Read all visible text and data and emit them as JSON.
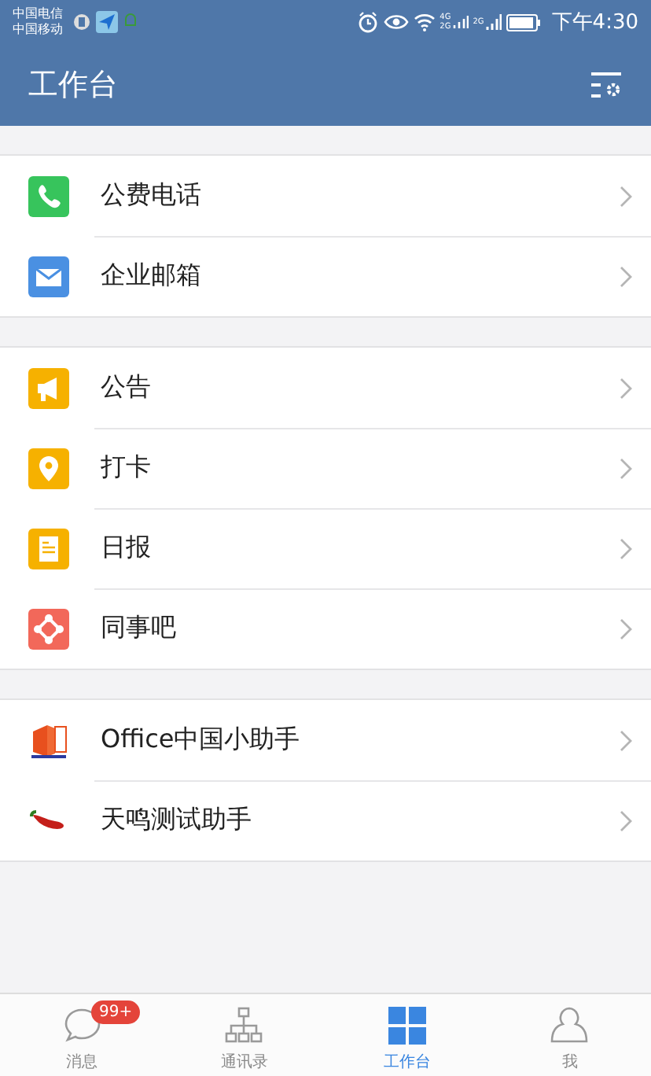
{
  "status_bar": {
    "carriers": [
      "中国电信",
      "中国移动"
    ],
    "network_labels": [
      "4G",
      "2G",
      "2G"
    ],
    "time": "下午4:30"
  },
  "header": {
    "title": "工作台"
  },
  "groups": [
    {
      "items": [
        {
          "label": "公费电话"
        },
        {
          "label": "企业邮箱"
        }
      ]
    },
    {
      "items": [
        {
          "label": "公告"
        },
        {
          "label": "打卡"
        },
        {
          "label": "日报"
        },
        {
          "label": "同事吧"
        }
      ]
    },
    {
      "items": [
        {
          "label": "Office中国小助手"
        },
        {
          "label": "天鸣测试助手"
        }
      ]
    }
  ],
  "tab_bar": [
    {
      "label": "消息",
      "selected": false,
      "badge": "99+"
    },
    {
      "label": "通讯录",
      "selected": false
    },
    {
      "label": "工作台",
      "selected": true
    },
    {
      "label": "我",
      "selected": false
    }
  ]
}
